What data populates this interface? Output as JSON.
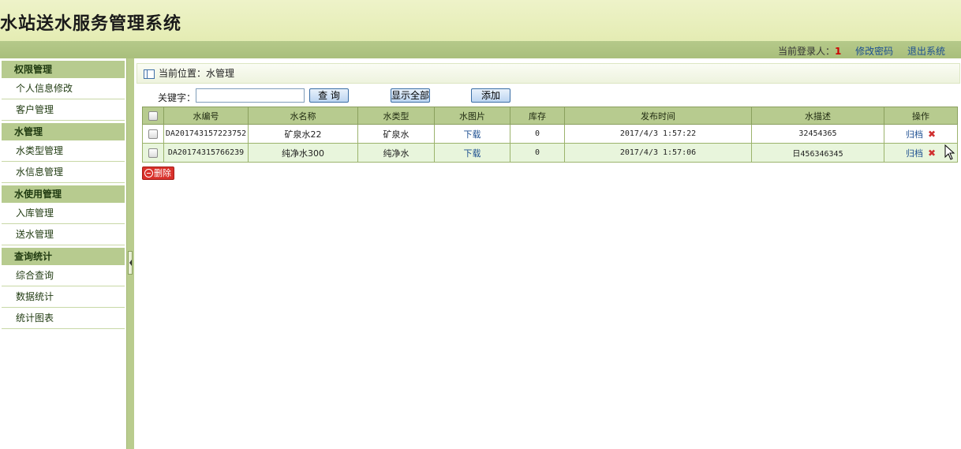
{
  "header": {
    "title": "水站送水服务管理系统",
    "login_label": "当前登录人：",
    "login_user": "1",
    "change_password": "修改密码",
    "logout": "退出系统"
  },
  "sidebar": {
    "groups": [
      {
        "title": "权限管理",
        "items": [
          "个人信息修改",
          "客户管理"
        ]
      },
      {
        "title": "水管理",
        "items": [
          "水类型管理",
          "水信息管理"
        ]
      },
      {
        "title": "水使用管理",
        "items": [
          "入库管理",
          "送水管理"
        ]
      },
      {
        "title": "查询统计",
        "items": [
          "综合查询",
          "数据统计",
          "统计图表"
        ]
      }
    ]
  },
  "main": {
    "breadcrumb": "当前位置：水管理",
    "search": {
      "label": "关键字：",
      "value": "",
      "query_button": "查 询",
      "show_all_button": "显示全部",
      "add_button": "添加"
    },
    "table": {
      "headers": [
        "",
        "水编号",
        "水名称",
        "水类型",
        "水图片",
        "库存",
        "发布时间",
        "水描述",
        "操作"
      ],
      "rows": [
        {
          "id": "DA201743157223752",
          "name": "矿泉水22",
          "type": "矿泉水",
          "picture": "下载",
          "stock": "0",
          "time": "2017/4/3 1:57:22",
          "desc": "32454365",
          "archive": "归档"
        },
        {
          "id": "DA20174315766239",
          "name": "纯净水300",
          "type": "纯净水",
          "picture": "下载",
          "stock": "0",
          "time": "2017/4/3 1:57:06",
          "desc": "日456346345",
          "archive": "归档"
        }
      ]
    },
    "delete_button": "删除"
  },
  "colors": {
    "header_bg": "#e4ecb3",
    "nav_green": "#b7cb8f",
    "delete_red": "#d9312b",
    "link_blue": "#1d4f91"
  }
}
